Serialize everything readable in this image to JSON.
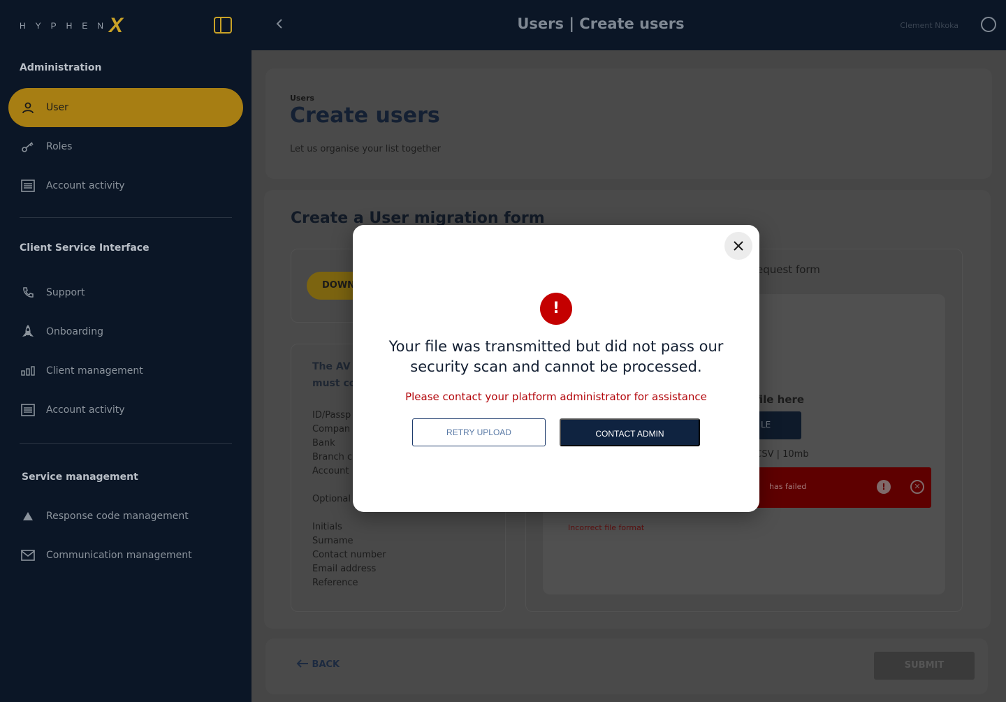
{
  "brand": {
    "letters": "HYPHEN",
    "x": "X"
  },
  "sidebar": {
    "sections": [
      {
        "title": "Administration",
        "items": [
          {
            "label": "User",
            "icon": "user-icon",
            "active": true
          },
          {
            "label": "Roles",
            "icon": "key-icon"
          },
          {
            "label": "Account activity",
            "icon": "list-icon"
          }
        ]
      },
      {
        "title": "Client Service Interface",
        "items": [
          {
            "label": "Support",
            "icon": "phone-icon"
          },
          {
            "label": "Onboarding",
            "icon": "rocket-icon"
          },
          {
            "label": "Client management",
            "icon": "bar-chart-icon"
          },
          {
            "label": "Account activity",
            "icon": "list-icon"
          }
        ]
      },
      {
        "title": "Service management",
        "items": [
          {
            "label": "Response code management",
            "icon": "triangle-icon"
          },
          {
            "label": "Communication management",
            "icon": "mail-icon"
          }
        ]
      }
    ]
  },
  "topbar": {
    "title": "Users | Create users",
    "user_name": "Clement Nkoka"
  },
  "header_card": {
    "crumb": "Users",
    "title": "Create users",
    "subtitle": "Let us organise your list together"
  },
  "form": {
    "title": "Create a User migration form",
    "download_label": "DOWN",
    "avs_line1": "The AV",
    "avs_line2": "must co",
    "required_fields": [
      "ID/Passp",
      "Compan",
      "Bank",
      "Branch c",
      "Account"
    ],
    "optional_label": "Optional",
    "optional_fields": [
      "Initials",
      "Surname",
      "Contact number",
      "Email address",
      "Reference"
    ],
    "upload_title": "equest form",
    "drop_text": "file here",
    "browse_label": "LE",
    "file_info": ", CSV | 10mb",
    "error_bar_text": "has failed",
    "error_caption": "Incorrect file format"
  },
  "footer": {
    "back_label": "BACK",
    "submit_label": "SUBMIT"
  },
  "modal": {
    "alert_glyph": "!",
    "headline": "Your file was transmitted but did not pass our security scan and cannot be processed.",
    "note": "Please contact your platform administrator for assistance",
    "retry_label": "RETRY UPLOAD",
    "contact_label": "CONTACT ADMIN"
  },
  "colors": {
    "accent": "#c9a227",
    "navy": "#0f2340",
    "error": "#c40000"
  }
}
